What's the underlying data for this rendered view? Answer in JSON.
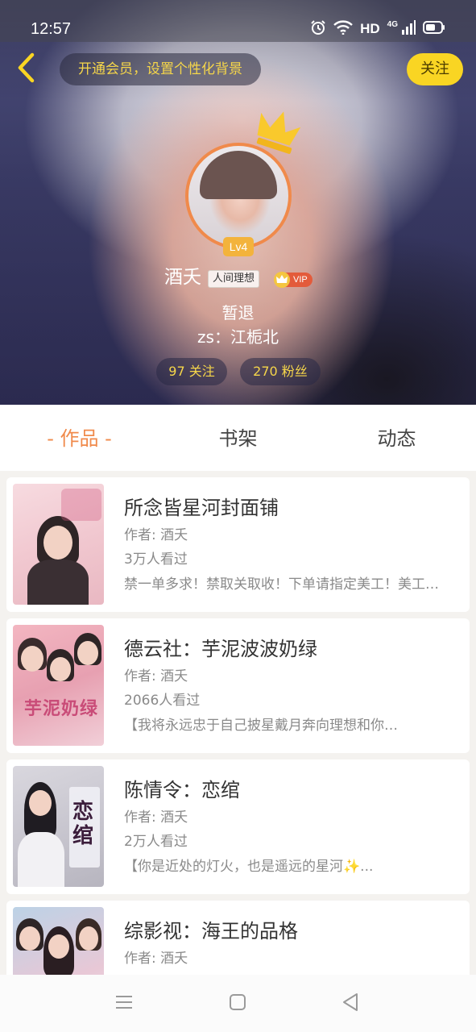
{
  "status_bar": {
    "time": "12:57",
    "hd": "HD",
    "network": "4G",
    "icons": [
      "alarm-icon",
      "wifi-icon",
      "signal-icon",
      "battery-icon"
    ]
  },
  "header": {
    "back_icon": "chevron-left-icon",
    "vip_prompt": "开通会员，设置个性化背景",
    "follow_label": "关注"
  },
  "profile": {
    "level": "Lv4",
    "name": "酒夭",
    "tag": "人间理想",
    "vip_label": "VIP",
    "bio_line1": "暂退",
    "bio_line2": "zs：江栀北",
    "following": "97 关注",
    "fans": "270 粉丝"
  },
  "tabs": [
    {
      "label": "- 作品 -",
      "active": true
    },
    {
      "label": "书架",
      "active": false
    },
    {
      "label": "动态",
      "active": false
    }
  ],
  "books": [
    {
      "title": "所念皆星河封面铺",
      "author": "作者: 酒夭",
      "views": "3万人看过",
      "desc": "禁一单多求！禁取关取收！下单请指定美工！美工…"
    },
    {
      "title": "德云社：芋泥波波奶绿",
      "author": "作者: 酒夭",
      "views": "2066人看过",
      "desc": "【我将永远忠于自己披星戴月奔向理想和你…"
    },
    {
      "title": "陈情令：恋绾",
      "author": "作者: 酒夭",
      "views": "2万人看过",
      "desc": "【你是近处的灯火，也是遥远的星河✨..."
    },
    {
      "title": "综影视：海王的品格",
      "author": "作者: 酒夭",
      "views": "",
      "desc": ""
    }
  ],
  "cover_text": {
    "book2": "芋泥奶绿",
    "book3": "恋绾"
  },
  "colors": {
    "accent": "#f08a4b",
    "follow_yellow": "#f9d523",
    "vip_text_yellow": "#f6d64a",
    "vip_red": "#e35b3b"
  },
  "navbar": {
    "icons": [
      "menu-icon",
      "home-square-icon",
      "back-triangle-icon"
    ]
  }
}
